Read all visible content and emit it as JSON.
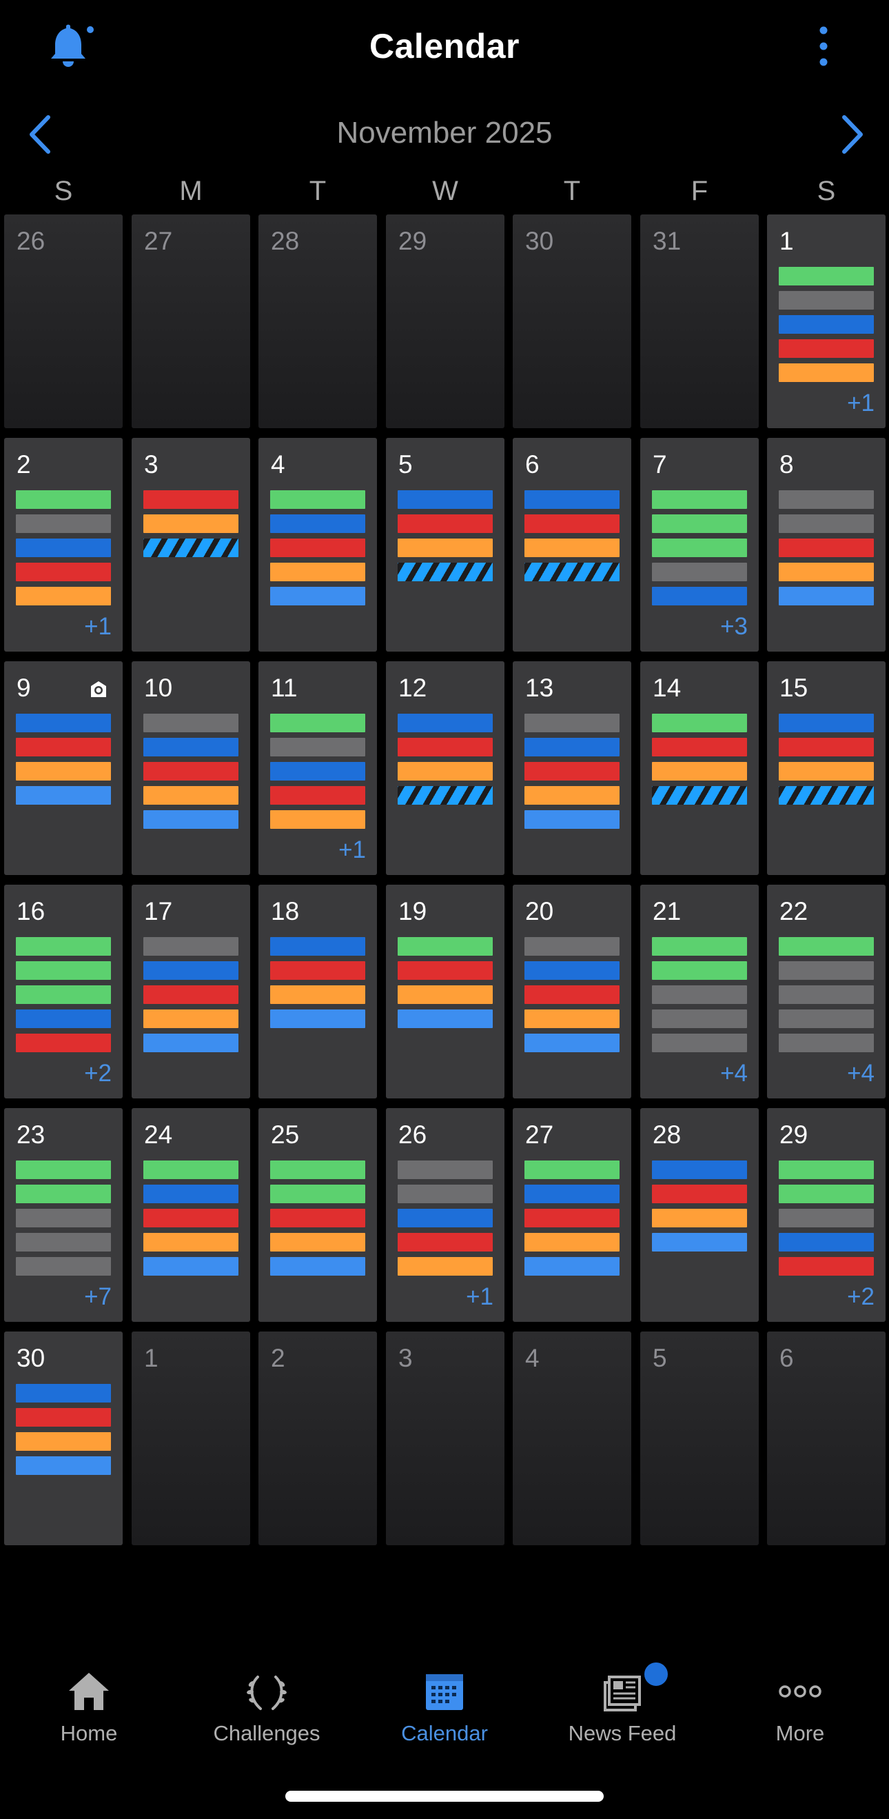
{
  "header": {
    "title": "Calendar",
    "notification_icon": "bell-icon",
    "menu_icon": "kebab-icon"
  },
  "month_nav": {
    "label": "November 2025"
  },
  "weekdays": [
    "S",
    "M",
    "T",
    "W",
    "T",
    "F",
    "S"
  ],
  "colors": {
    "accent": "#4a90e2",
    "green": "#5cd16f",
    "gray": "#6e6e70",
    "blue": "#1e6fd9",
    "red": "#e02f2f",
    "orange": "#ff9f38",
    "lightblue": "#3d8ef0",
    "hatch": "#1ea1ff"
  },
  "weeks": [
    [
      {
        "day": "26",
        "current": false,
        "events": [],
        "more": ""
      },
      {
        "day": "27",
        "current": false,
        "events": [],
        "more": ""
      },
      {
        "day": "28",
        "current": false,
        "events": [],
        "more": ""
      },
      {
        "day": "29",
        "current": false,
        "events": [],
        "more": ""
      },
      {
        "day": "30",
        "current": false,
        "events": [],
        "more": ""
      },
      {
        "day": "31",
        "current": false,
        "events": [],
        "more": ""
      },
      {
        "day": "1",
        "current": true,
        "events": [
          "green",
          "gray",
          "blue",
          "red",
          "orange"
        ],
        "more": "+1"
      }
    ],
    [
      {
        "day": "2",
        "current": true,
        "events": [
          "green",
          "gray",
          "blue",
          "red",
          "orange"
        ],
        "more": "+1"
      },
      {
        "day": "3",
        "current": true,
        "events": [
          "red",
          "orange",
          "hatch"
        ],
        "more": ""
      },
      {
        "day": "4",
        "current": true,
        "events": [
          "green",
          "blue",
          "red",
          "orange",
          "lightblue"
        ],
        "more": ""
      },
      {
        "day": "5",
        "current": true,
        "events": [
          "blue",
          "red",
          "orange",
          "hatch"
        ],
        "more": ""
      },
      {
        "day": "6",
        "current": true,
        "events": [
          "blue",
          "red",
          "orange",
          "hatch"
        ],
        "more": ""
      },
      {
        "day": "7",
        "current": true,
        "events": [
          "green",
          "green",
          "green",
          "gray",
          "blue"
        ],
        "more": "+3"
      },
      {
        "day": "8",
        "current": true,
        "events": [
          "gray",
          "gray",
          "red",
          "orange",
          "lightblue"
        ],
        "more": ""
      }
    ],
    [
      {
        "day": "9",
        "current": true,
        "events": [
          "blue",
          "red",
          "orange",
          "lightblue"
        ],
        "more": "",
        "icon": "medal-icon"
      },
      {
        "day": "10",
        "current": true,
        "events": [
          "gray",
          "blue",
          "red",
          "orange",
          "lightblue"
        ],
        "more": ""
      },
      {
        "day": "11",
        "current": true,
        "events": [
          "green",
          "gray",
          "blue",
          "red",
          "orange"
        ],
        "more": "+1"
      },
      {
        "day": "12",
        "current": true,
        "events": [
          "blue",
          "red",
          "orange",
          "hatch"
        ],
        "more": ""
      },
      {
        "day": "13",
        "current": true,
        "events": [
          "gray",
          "blue",
          "red",
          "orange",
          "lightblue"
        ],
        "more": ""
      },
      {
        "day": "14",
        "current": true,
        "events": [
          "green",
          "red",
          "orange",
          "hatch"
        ],
        "more": ""
      },
      {
        "day": "15",
        "current": true,
        "events": [
          "blue",
          "red",
          "orange",
          "hatch"
        ],
        "more": ""
      }
    ],
    [
      {
        "day": "16",
        "current": true,
        "events": [
          "green",
          "green",
          "green",
          "blue",
          "red"
        ],
        "more": "+2"
      },
      {
        "day": "17",
        "current": true,
        "events": [
          "gray",
          "blue",
          "red",
          "orange",
          "lightblue"
        ],
        "more": ""
      },
      {
        "day": "18",
        "current": true,
        "events": [
          "blue",
          "red",
          "orange",
          "lightblue"
        ],
        "more": ""
      },
      {
        "day": "19",
        "current": true,
        "events": [
          "green",
          "red",
          "orange",
          "lightblue"
        ],
        "more": ""
      },
      {
        "day": "20",
        "current": true,
        "events": [
          "gray",
          "blue",
          "red",
          "orange",
          "lightblue"
        ],
        "more": ""
      },
      {
        "day": "21",
        "current": true,
        "events": [
          "green",
          "green",
          "gray",
          "gray",
          "gray"
        ],
        "more": "+4"
      },
      {
        "day": "22",
        "current": true,
        "events": [
          "green",
          "gray",
          "gray",
          "gray",
          "gray"
        ],
        "more": "+4"
      }
    ],
    [
      {
        "day": "23",
        "current": true,
        "events": [
          "green",
          "green",
          "gray",
          "gray",
          "gray"
        ],
        "more": "+7"
      },
      {
        "day": "24",
        "current": true,
        "events": [
          "green",
          "blue",
          "red",
          "orange",
          "lightblue"
        ],
        "more": ""
      },
      {
        "day": "25",
        "current": true,
        "events": [
          "green",
          "green",
          "red",
          "orange",
          "lightblue"
        ],
        "more": ""
      },
      {
        "day": "26",
        "current": true,
        "events": [
          "gray",
          "gray",
          "blue",
          "red",
          "orange"
        ],
        "more": "+1"
      },
      {
        "day": "27",
        "current": true,
        "events": [
          "green",
          "blue",
          "red",
          "orange",
          "lightblue"
        ],
        "more": ""
      },
      {
        "day": "28",
        "current": true,
        "events": [
          "blue",
          "red",
          "orange",
          "lightblue"
        ],
        "more": ""
      },
      {
        "day": "29",
        "current": true,
        "events": [
          "green",
          "green",
          "gray",
          "blue",
          "red"
        ],
        "more": "+2"
      }
    ],
    [
      {
        "day": "30",
        "current": true,
        "events": [
          "blue",
          "red",
          "orange",
          "lightblue"
        ],
        "more": ""
      },
      {
        "day": "1",
        "current": false,
        "events": [],
        "more": ""
      },
      {
        "day": "2",
        "current": false,
        "events": [],
        "more": ""
      },
      {
        "day": "3",
        "current": false,
        "events": [],
        "more": ""
      },
      {
        "day": "4",
        "current": false,
        "events": [],
        "more": ""
      },
      {
        "day": "5",
        "current": false,
        "events": [],
        "more": ""
      },
      {
        "day": "6",
        "current": false,
        "events": [],
        "more": ""
      }
    ]
  ],
  "tabs": [
    {
      "label": "Home",
      "icon": "home-icon",
      "active": false
    },
    {
      "label": "Challenges",
      "icon": "laurel-icon",
      "active": false
    },
    {
      "label": "Calendar",
      "icon": "calendar-icon",
      "active": true
    },
    {
      "label": "News Feed",
      "icon": "newspaper-icon",
      "active": false,
      "badge": true
    },
    {
      "label": "More",
      "icon": "more-dots-icon",
      "active": false
    }
  ]
}
